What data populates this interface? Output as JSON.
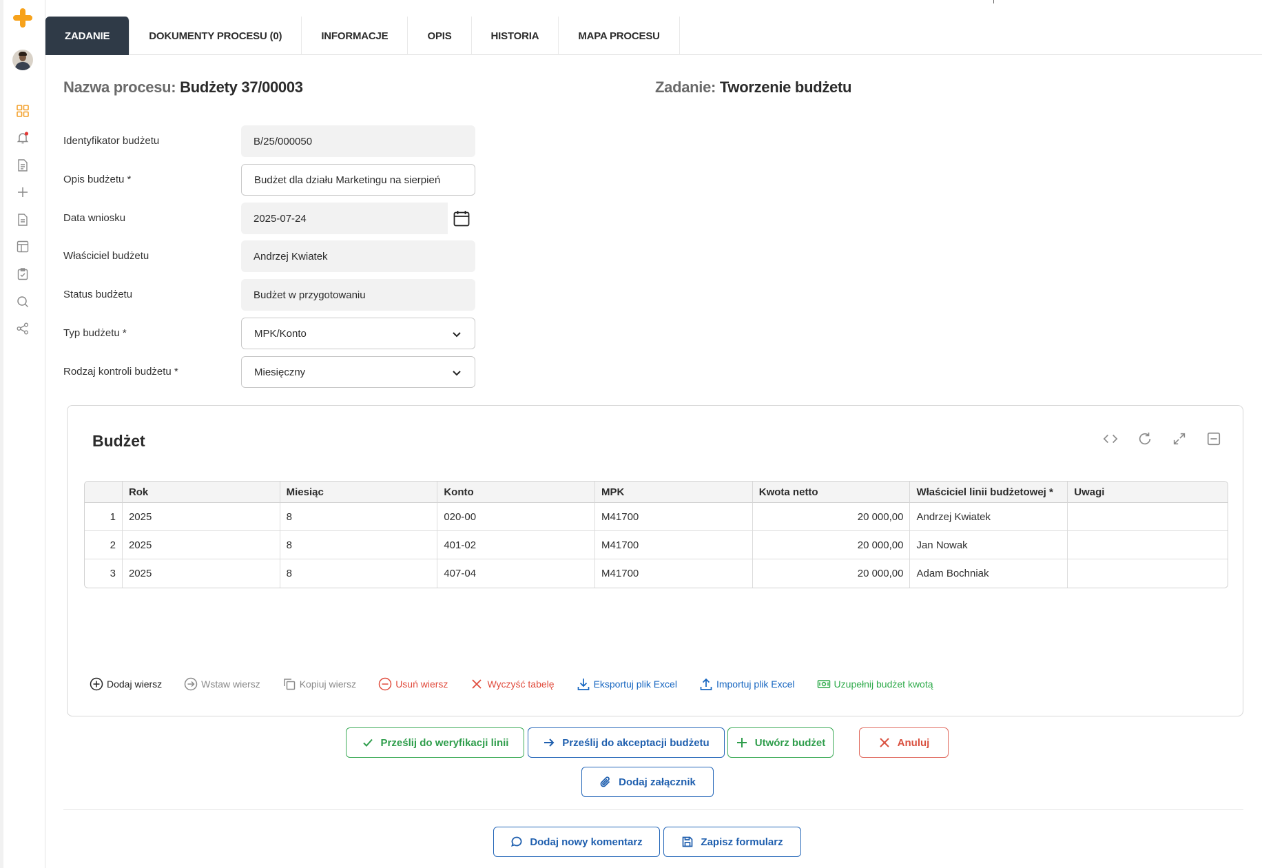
{
  "tabs": [
    {
      "label": "ZADANIE",
      "active": true
    },
    {
      "label": "DOKUMENTY PROCESU (0)",
      "active": false
    },
    {
      "label": "INFORMACJE",
      "active": false
    },
    {
      "label": "OPIS",
      "active": false
    },
    {
      "label": "HISTORIA",
      "active": false
    },
    {
      "label": "MAPA PROCESU",
      "active": false
    }
  ],
  "header": {
    "process_label": "Nazwa procesu:",
    "process_value": "Budżety 37/00003",
    "task_label": "Zadanie:",
    "task_value": "Tworzenie budżetu"
  },
  "form": {
    "fields": [
      {
        "label": "Identyfikator budżetu",
        "value": "B/25/000050"
      },
      {
        "label": "Opis budżetu *",
        "value": "Budżet dla działu Marketingu na sierpień"
      },
      {
        "label": "Data wniosku",
        "value": "2025-07-24"
      },
      {
        "label": "Właściciel budżetu",
        "value": "Andrzej Kwiatek"
      },
      {
        "label": "Status budżetu",
        "value": "Budżet w przygotowaniu"
      },
      {
        "label": "Typ budżetu *",
        "value": "MPK/Konto"
      },
      {
        "label": "Rodzaj kontroli budżetu *",
        "value": "Miesięczny"
      }
    ]
  },
  "budget": {
    "title": "Budżet",
    "columns": [
      "",
      "Rok",
      "Miesiąc",
      "Konto",
      "MPK",
      "Kwota netto",
      "Właściciel linii budżetowej *",
      "Uwagi"
    ],
    "rows": [
      [
        "1",
        "2025",
        "8",
        "020-00",
        "M41700",
        "20 000,00",
        "Andrzej Kwiatek",
        ""
      ],
      [
        "2",
        "2025",
        "8",
        "401-02",
        "M41700",
        "20 000,00",
        "Jan Nowak",
        ""
      ],
      [
        "3",
        "2025",
        "8",
        "407-04",
        "M41700",
        "20 000,00",
        "Adam Bochniak",
        ""
      ]
    ],
    "actions": {
      "add_row": "Dodaj wiersz",
      "insert_row": "Wstaw wiersz",
      "copy_row": "Kopiuj wiersz",
      "delete_row": "Usuń wiersz",
      "clear_table": "Wyczyść tabelę",
      "export_excel": "Eksportuj plik Excel",
      "import_excel": "Importuj plik Excel",
      "fill_amount": "Uzupełnij budżet kwotą"
    }
  },
  "buttons": {
    "send_verification": "Prześlij do weryfikacji linii",
    "send_acceptance": "Prześlij do akceptacji budżetu",
    "create_budget": "Utwórz budżet",
    "cancel": "Anuluj",
    "add_attachment": "Dodaj załącznik",
    "add_comment": "Dodaj nowy komentarz",
    "save_form": "Zapisz formularz"
  },
  "colors": {
    "accent_orange": "#f7a21b",
    "tab_active_bg": "#2f3a47",
    "green": "#2e9d4b",
    "blue": "#1f5fae",
    "red": "#d9503f"
  }
}
